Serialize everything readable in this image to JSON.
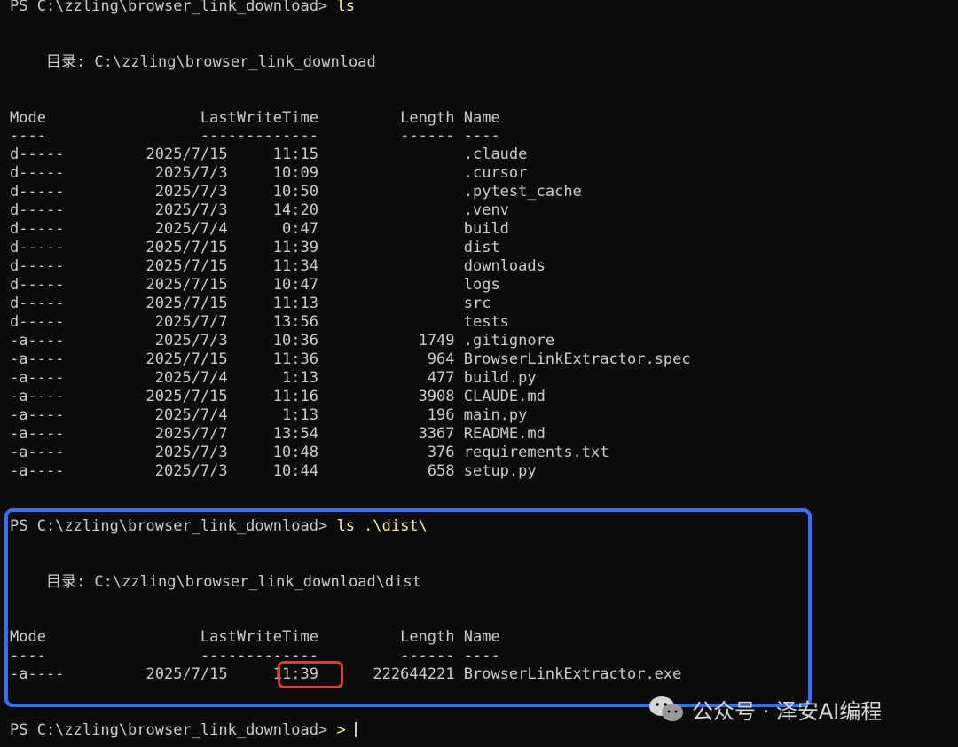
{
  "terminal": {
    "prompt": "PS C:\\zzling\\browser_link_download> ",
    "first_command": "ls",
    "first_dir_line": "    目录: C:\\zzling\\browser_link_download",
    "headers_line": "Mode                 LastWriteTime         Length Name",
    "underline": "----                 -------------         ------ ----",
    "listing": [
      "d-----         2025/7/15     11:15                .claude",
      "d-----          2025/7/3     10:09                .cursor",
      "d-----          2025/7/3     10:50                .pytest_cache",
      "d-----          2025/7/3     14:20                .venv",
      "d-----          2025/7/4      0:47                build",
      "d-----         2025/7/15     11:39                dist",
      "d-----         2025/7/15     11:34                downloads",
      "d-----         2025/7/15     10:47                logs",
      "d-----         2025/7/15     11:13                src",
      "d-----          2025/7/7     13:56                tests",
      "-a----          2025/7/3     10:36           1749 .gitignore",
      "-a----         2025/7/15     11:36            964 BrowserLinkExtractor.spec",
      "-a----          2025/7/4      1:13            477 build.py",
      "-a----         2025/7/15     11:16           3908 CLAUDE.md",
      "-a----          2025/7/4      1:13            196 main.py",
      "-a----          2025/7/7     13:54           3367 README.md",
      "-a----          2025/7/3     10:48            376 requirements.txt",
      "-a----          2025/7/3     10:44            658 setup.py"
    ],
    "second_command": "ls .\\dist\\",
    "second_dir_line": "    目录: C:\\zzling\\browser_link_download\\dist",
    "dist_listing": [
      "-a----         2025/7/15     11:39      222644221 BrowserLinkExtractor.exe"
    ],
    "final_prompt": "PS C:\\zzling\\browser_link_download> "
  },
  "watermark": {
    "text": "公众号 · 泽安AI编程",
    "icon": "wechat-icon"
  },
  "colors": {
    "background": "#0c0c0c",
    "text": "#cccccc",
    "command": "#f9f1a5",
    "highlight_blue": "#3b6cf6",
    "highlight_red": "#e53935"
  }
}
